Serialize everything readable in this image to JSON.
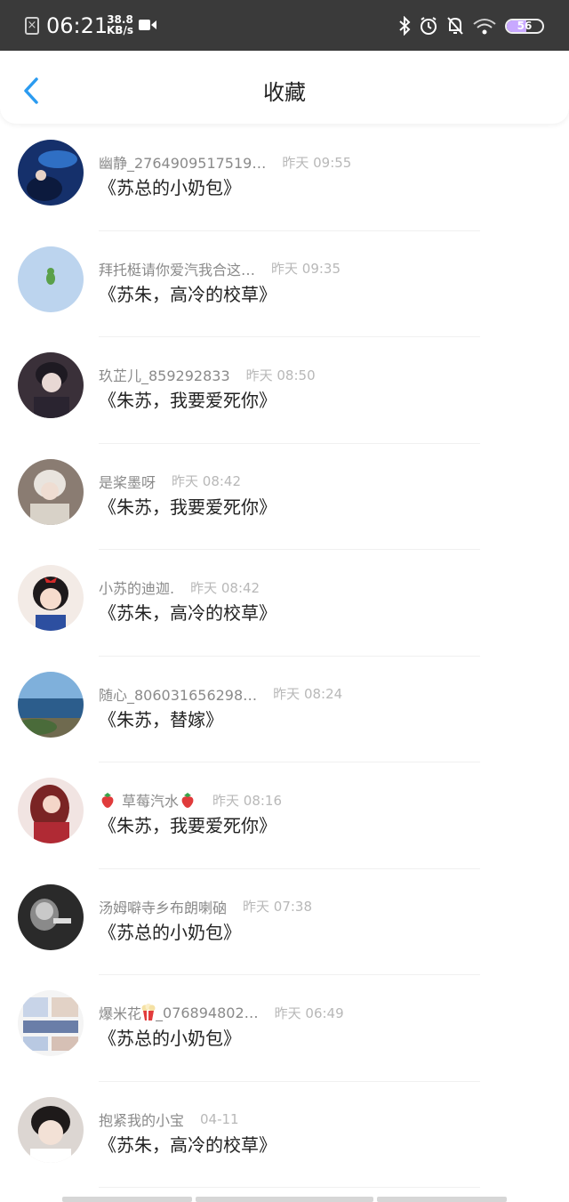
{
  "status_bar": {
    "time": "06:21",
    "speed_value": "38.8",
    "speed_unit": "KB/s",
    "battery": "56",
    "battery_level_percent": 56
  },
  "header": {
    "title": "收藏"
  },
  "colors": {
    "accent": "#2b9bf0",
    "status_bar_bg": "#3a3a3a"
  },
  "items": [
    {
      "username": "幽静_2764909517519…",
      "time": "昨天 09:55",
      "book": "《苏总的小奶包》"
    },
    {
      "username": "拜托梃请你爱汽我合这…",
      "time": "昨天 09:35",
      "book": "《苏朱，高冷的校草》"
    },
    {
      "username": "玖芷儿_859292833",
      "time": "昨天 08:50",
      "book": "《朱苏，我要爱死你》"
    },
    {
      "username": "是桨墨呀",
      "time": "昨天 08:42",
      "book": "《朱苏，我要爱死你》"
    },
    {
      "username": "小苏的迪迦.",
      "time": "昨天 08:42",
      "book": "《苏朱，高冷的校草》"
    },
    {
      "username": "随心_806031656298…",
      "time": "昨天 08:24",
      "book": "《朱苏，替嫁》"
    },
    {
      "username": "草莓汽水",
      "time": "昨天 08:16",
      "book": "《朱苏，我要爱死你》"
    },
    {
      "username": "汤姆噼寺乡布朗喇硇",
      "time": "昨天 07:38",
      "book": "《苏总的小奶包》"
    },
    {
      "username": "_076894802…",
      "username_prefix": "爆米花",
      "time": "昨天 06:49",
      "book": "《苏总的小奶包》"
    },
    {
      "username": "抱紧我的小宝",
      "time": "04-11",
      "book": "《苏朱，高冷的校草》"
    }
  ]
}
